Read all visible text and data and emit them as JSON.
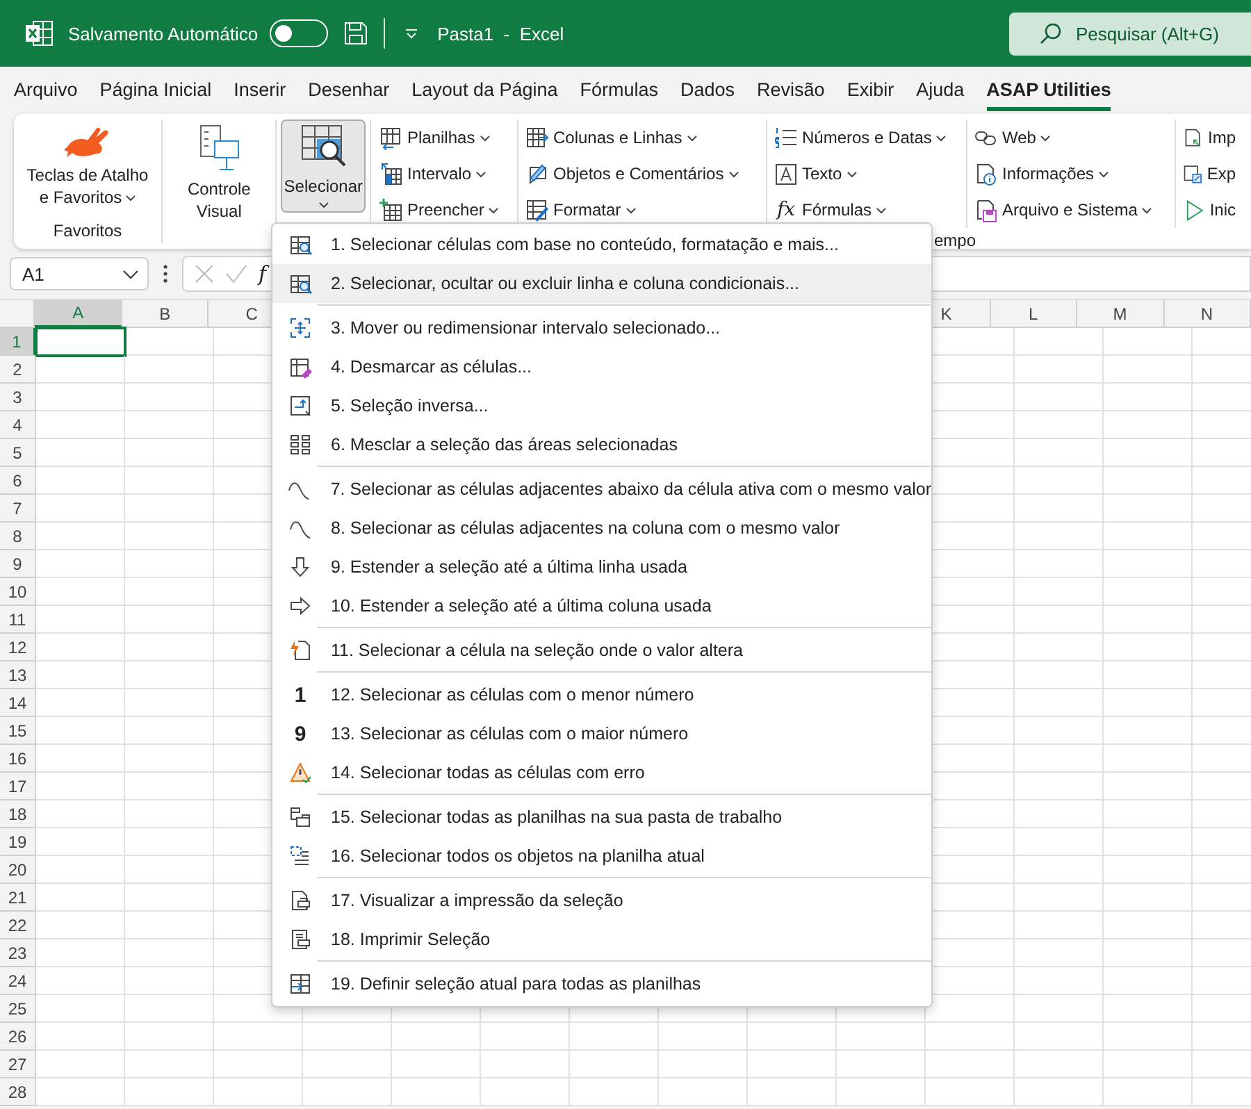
{
  "title_bar": {
    "autosave_label": "Salvamento Automático",
    "autosave_on": false,
    "document_title": "Pasta1  -  Excel",
    "search": {
      "placeholder": "Pesquisar (Alt+G)"
    }
  },
  "tabs": [
    {
      "label": "Arquivo",
      "selected": false
    },
    {
      "label": "Página Inicial",
      "selected": false
    },
    {
      "label": "Inserir",
      "selected": false
    },
    {
      "label": "Desenhar",
      "selected": false
    },
    {
      "label": "Layout da Página",
      "selected": false
    },
    {
      "label": "Fórmulas",
      "selected": false
    },
    {
      "label": "Dados",
      "selected": false
    },
    {
      "label": "Revisão",
      "selected": false
    },
    {
      "label": "Exibir",
      "selected": false
    },
    {
      "label": "Ajuda",
      "selected": false
    },
    {
      "label": "ASAP Utilities",
      "selected": true
    }
  ],
  "ribbon": {
    "large_buttons": [
      {
        "label": "Teclas de Atalho e Favoritos",
        "dropdown": true,
        "pressed": false,
        "group_label": "Favoritos"
      },
      {
        "label": "Controle Visual",
        "dropdown": false,
        "pressed": false
      },
      {
        "label": "Selecionar",
        "dropdown": true,
        "pressed": true
      }
    ],
    "small_columns": [
      [
        {
          "label": "Planilhas",
          "dropdown": true
        },
        {
          "label": "Intervalo",
          "dropdown": true
        },
        {
          "label": "Preencher",
          "dropdown": true
        }
      ],
      [
        {
          "label": "Colunas e Linhas",
          "dropdown": true
        },
        {
          "label": "Objetos e Comentários",
          "dropdown": true
        },
        {
          "label": "Formatar",
          "dropdown": true
        }
      ],
      [
        {
          "label": "Números e Datas",
          "dropdown": true
        },
        {
          "label": "Texto",
          "dropdown": true
        },
        {
          "label": "Fórmulas",
          "dropdown": true,
          "glyph": "fx"
        }
      ],
      [
        {
          "label": "Web",
          "dropdown": true
        },
        {
          "label": "Informações",
          "dropdown": true
        },
        {
          "label": "Arquivo e Sistema",
          "dropdown": true
        }
      ],
      [
        {
          "label": "Imp",
          "dropdown": false
        },
        {
          "label": "Exp",
          "dropdown": false
        },
        {
          "label": "Inic",
          "dropdown": false
        }
      ]
    ],
    "footer_label": "empo"
  },
  "formula_bar": {
    "name_box": "A1",
    "function_label": "f"
  },
  "sheet": {
    "columns": [
      {
        "label": "A",
        "selected": true
      },
      {
        "label": "B",
        "selected": false
      },
      {
        "label": "C",
        "selected": false
      },
      {
        "label": "K",
        "selected": false
      },
      {
        "label": "L",
        "selected": false
      },
      {
        "label": "M",
        "selected": false
      },
      {
        "label": "N",
        "selected": false
      }
    ],
    "rows": [
      {
        "label": "1",
        "selected": true
      },
      {
        "label": "2",
        "selected": false
      },
      {
        "label": "3",
        "selected": false
      },
      {
        "label": "4",
        "selected": false
      },
      {
        "label": "5",
        "selected": false
      },
      {
        "label": "6",
        "selected": false
      },
      {
        "label": "7",
        "selected": false
      },
      {
        "label": "8",
        "selected": false
      },
      {
        "label": "9",
        "selected": false
      },
      {
        "label": "10",
        "selected": false
      },
      {
        "label": "11",
        "selected": false
      },
      {
        "label": "12",
        "selected": false
      },
      {
        "label": "13",
        "selected": false
      },
      {
        "label": "14",
        "selected": false
      },
      {
        "label": "15",
        "selected": false
      },
      {
        "label": "16",
        "selected": false
      },
      {
        "label": "17",
        "selected": false
      },
      {
        "label": "18",
        "selected": false
      },
      {
        "label": "19",
        "selected": false
      },
      {
        "label": "20",
        "selected": false
      },
      {
        "label": "21",
        "selected": false
      },
      {
        "label": "22",
        "selected": false
      },
      {
        "label": "23",
        "selected": false
      },
      {
        "label": "24",
        "selected": false
      },
      {
        "label": "25",
        "selected": false
      },
      {
        "label": "26",
        "selected": false
      },
      {
        "label": "27",
        "selected": false
      },
      {
        "label": "28",
        "selected": false
      }
    ]
  },
  "menu": {
    "groups": [
      {
        "items": [
          {
            "label": "1. Selecionar células com base no conteúdo, formatação e mais...",
            "selected": false
          },
          {
            "label": "2. Selecionar, ocultar ou excluir linha e coluna condicionais...",
            "selected": true
          }
        ]
      },
      {
        "items": [
          {
            "label": "3. Mover ou redimensionar intervalo selecionado...",
            "selected": false
          },
          {
            "label": "4. Desmarcar as células...",
            "selected": false
          },
          {
            "label": "5. Seleção inversa...",
            "selected": false
          },
          {
            "label": "6. Mesclar a seleção das áreas selecionadas",
            "selected": false
          }
        ]
      },
      {
        "items": [
          {
            "label": "7. Selecionar as células adjacentes abaixo da célula ativa com o mesmo valor",
            "selected": false
          },
          {
            "label": "8. Selecionar as células adjacentes na coluna com o mesmo valor",
            "selected": false
          },
          {
            "label": "9. Estender a seleção até a última linha usada",
            "selected": false
          },
          {
            "label": "10. Estender a seleção até a última coluna usada",
            "selected": false
          }
        ]
      },
      {
        "items": [
          {
            "label": "11. Selecionar a célula na seleção onde o valor altera",
            "selected": false
          }
        ]
      },
      {
        "items": [
          {
            "label": "12. Selecionar as células com o menor número",
            "selected": false,
            "glyph": "1"
          },
          {
            "label": "13. Selecionar as células com o maior número",
            "selected": false,
            "glyph": "9"
          },
          {
            "label": "14. Selecionar todas as células com erro",
            "selected": false
          }
        ]
      },
      {
        "items": [
          {
            "label": "15. Selecionar todas as planilhas na sua pasta de trabalho",
            "selected": false
          },
          {
            "label": "16. Selecionar todos os objetos na planilha atual",
            "selected": false
          }
        ]
      },
      {
        "items": [
          {
            "label": "17. Visualizar a impressão da seleção",
            "selected": false
          },
          {
            "label": "18. Imprimir Seleção",
            "selected": false
          }
        ]
      },
      {
        "items": [
          {
            "label": "19. Definir seleção atual para todas as planilhas",
            "selected": false
          }
        ]
      }
    ]
  }
}
